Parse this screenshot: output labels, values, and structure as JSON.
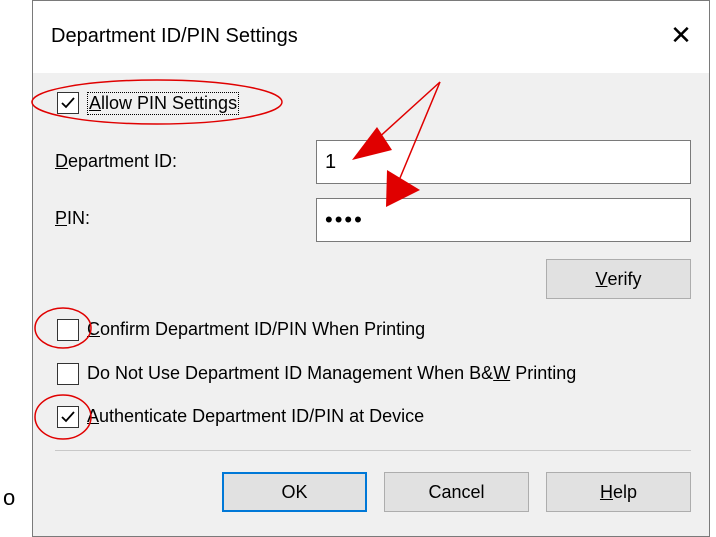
{
  "bullet": "o",
  "dialog": {
    "title": "Department ID/PIN Settings",
    "close_glyph": "✕"
  },
  "allow_pin": {
    "label_first": "A",
    "label_rest": "llow PIN Settings",
    "checked": true
  },
  "department_id": {
    "label_first": "D",
    "label_rest": "epartment ID:",
    "value": "1"
  },
  "pin": {
    "label_first": "P",
    "label_rest": "IN:",
    "value": "••••"
  },
  "verify": {
    "label_first": "V",
    "label_rest": "erify"
  },
  "options": [
    {
      "label_first": "C",
      "label_rest": "onfirm Department ID/PIN When Printing",
      "checked": false
    },
    {
      "label_before": "Do Not Use Department ID Management When B&",
      "label_u": "W",
      "label_after": " Printing",
      "checked": false
    },
    {
      "label_first": "A",
      "label_rest": "uthenticate Department ID/PIN at Device",
      "checked": true
    }
  ],
  "buttons": {
    "ok": "OK",
    "cancel": "Cancel",
    "help_first": "H",
    "help_rest": "elp"
  },
  "colors": {
    "annotation_red": "#e00000",
    "default_button_border": "#0078d7"
  }
}
